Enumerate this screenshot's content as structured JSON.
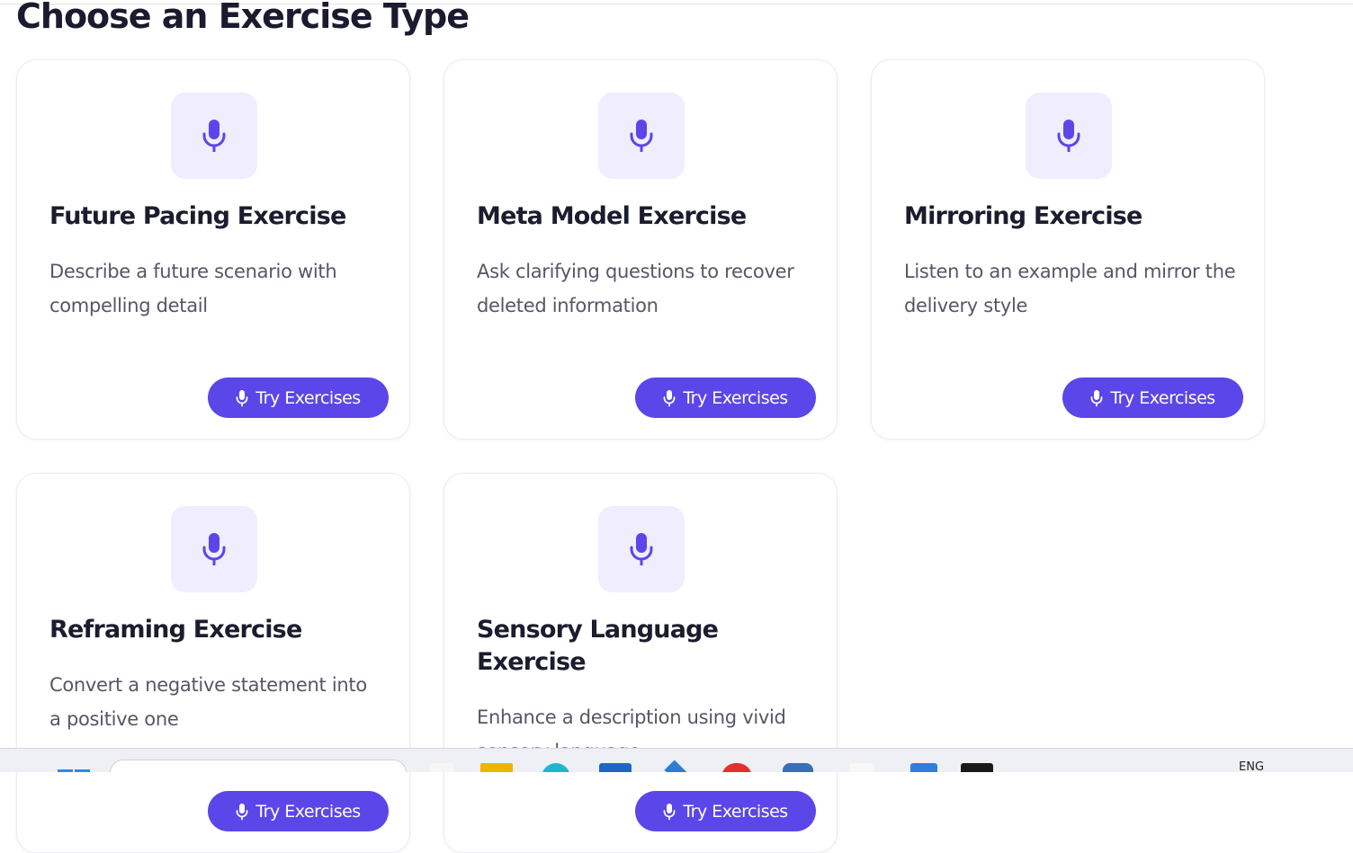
{
  "page": {
    "title": "Choose an Exercise Type"
  },
  "colors": {
    "accent": "#5b46ea",
    "icon_bg": "#efedfe",
    "title": "#1b1c2e",
    "description": "#555766"
  },
  "cards": [
    {
      "icon": "microphone-icon",
      "title": "Future Pacing Exercise",
      "description": "Describe a future scenario with compelling detail",
      "button_label": "Try Exercises"
    },
    {
      "icon": "microphone-icon",
      "title": "Meta Model Exercise",
      "description": "Ask clarifying questions to recover deleted information",
      "button_label": "Try Exercises"
    },
    {
      "icon": "microphone-icon",
      "title": "Mirroring Exercise",
      "description": "Listen to an example and mirror the delivery style",
      "button_label": "Try Exercises"
    },
    {
      "icon": "microphone-icon",
      "title": "Reframing Exercise",
      "description": "Convert a negative statement into a positive one",
      "button_label": "Try Exercises"
    },
    {
      "icon": "microphone-icon",
      "title": "Sensory Language Exercise",
      "description": "Enhance a description using vivid sensory language",
      "button_label": "Try Exercises"
    }
  ],
  "taskbar": {
    "language": "ENG"
  }
}
